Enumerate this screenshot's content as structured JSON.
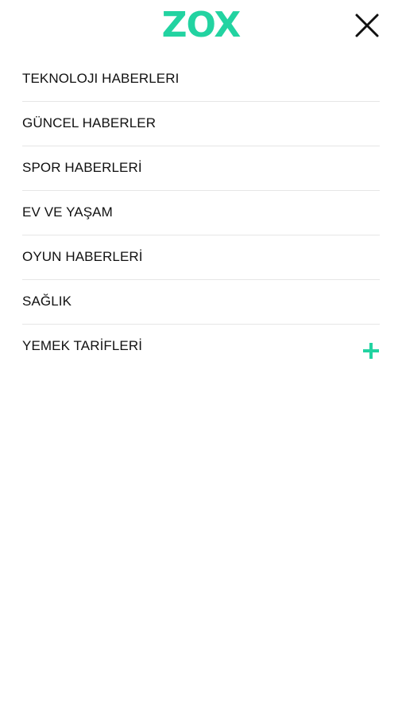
{
  "header": {
    "logo_text": "ZOX",
    "close_icon": "close-icon"
  },
  "colors": {
    "accent": "#22d3a1",
    "text": "#111111",
    "divider": "#e6e6e6"
  },
  "menu": {
    "items": [
      {
        "label": "TEKNOLOJI HABERLERI"
      },
      {
        "label": "GÜNCEL HABERLER"
      },
      {
        "label": "SPOR HABERLERİ"
      },
      {
        "label": "EV VE YAŞAM"
      },
      {
        "label": "OYUN HABERLERİ"
      },
      {
        "label": "SAĞLIK"
      },
      {
        "label": "YEMEK TARİFLERİ",
        "expand_icon": "plus-icon"
      }
    ]
  }
}
